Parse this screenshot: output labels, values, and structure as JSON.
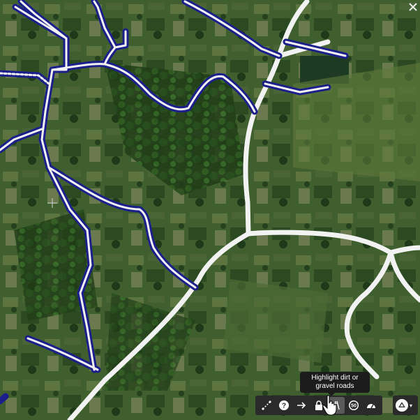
{
  "map": {
    "name": "satellite-map-view",
    "colors": {
      "highlighted_road": "#1c1f8a",
      "road": "#f2f2f2",
      "toolbar_bg": "#2a2a2a",
      "tooltip_bg": "#1c1c1c"
    }
  },
  "toolbar": {
    "buttons": [
      {
        "name": "measure-path-icon",
        "state": "normal"
      },
      {
        "name": "help-icon",
        "label": "?",
        "state": "normal"
      },
      {
        "name": "directions-arrow-icon",
        "state": "normal"
      },
      {
        "name": "lock-icon",
        "state": "normal"
      },
      {
        "name": "highlight-dirt-roads-icon",
        "state": "active"
      },
      {
        "name": "speed-limit-icon",
        "label": "50",
        "state": "normal"
      },
      {
        "name": "speedometer-icon",
        "state": "normal"
      }
    ],
    "tooltip": "Highlight dirt or gravel roads"
  },
  "layer_switcher": {
    "icon": "layers-compass-icon",
    "caret": "▾"
  }
}
